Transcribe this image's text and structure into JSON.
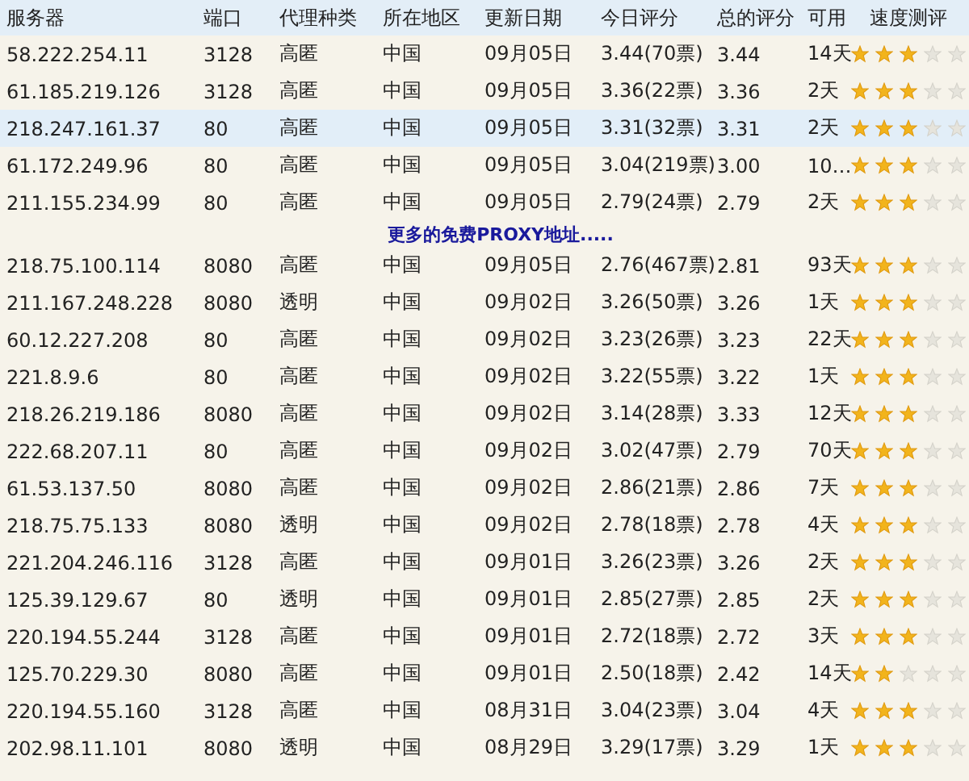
{
  "table": {
    "columns": [
      "服务器",
      "端口",
      "代理种类",
      "所在地区",
      "更新日期",
      "今日评分",
      "总的评分",
      "可用",
      "速度测评"
    ],
    "rows": [
      {
        "cells": [
          "58.222.254.11",
          "3128",
          "高匿",
          "中国",
          "09月05日",
          "3.44(70票)",
          "3.44",
          "14天"
        ],
        "stars": 3,
        "selected": false
      },
      {
        "cells": [
          "61.185.219.126",
          "3128",
          "高匿",
          "中国",
          "09月05日",
          "3.36(22票)",
          "3.36",
          "2天"
        ],
        "stars": 3,
        "selected": false
      },
      {
        "cells": [
          "218.247.161.37",
          "80",
          "高匿",
          "中国",
          "09月05日",
          "3.31(32票)",
          "3.31",
          "2天"
        ],
        "stars": 3,
        "selected": true
      },
      {
        "cells": [
          "61.172.249.96",
          "80",
          "高匿",
          "中国",
          "09月05日",
          "3.04(219票)",
          "3.00",
          "10…"
        ],
        "stars": 3,
        "selected": false
      },
      {
        "cells": [
          "211.155.234.99",
          "80",
          "高匿",
          "中国",
          "09月05日",
          "2.79(24票)",
          "2.79",
          "2天"
        ],
        "stars": 3,
        "selected": false
      }
    ],
    "more_link": "更多的免费PROXY地址.....",
    "rows_2": [
      {
        "cells": [
          "218.75.100.114",
          "8080",
          "高匿",
          "中国",
          "09月05日",
          "2.76(467票)",
          "2.81",
          "93天"
        ],
        "stars": 3,
        "selected": false
      },
      {
        "cells": [
          "211.167.248.228",
          "8080",
          "透明",
          "中国",
          "09月02日",
          "3.26(50票)",
          "3.26",
          "1天"
        ],
        "stars": 3,
        "selected": false
      },
      {
        "cells": [
          "60.12.227.208",
          "80",
          "高匿",
          "中国",
          "09月02日",
          "3.23(26票)",
          "3.23",
          "22天"
        ],
        "stars": 3,
        "selected": false
      },
      {
        "cells": [
          "221.8.9.6",
          "80",
          "高匿",
          "中国",
          "09月02日",
          "3.22(55票)",
          "3.22",
          "1天"
        ],
        "stars": 3,
        "selected": false
      },
      {
        "cells": [
          "218.26.219.186",
          "8080",
          "高匿",
          "中国",
          "09月02日",
          "3.14(28票)",
          "3.33",
          "12天"
        ],
        "stars": 3,
        "selected": false
      },
      {
        "cells": [
          "222.68.207.11",
          "80",
          "高匿",
          "中国",
          "09月02日",
          "3.02(47票)",
          "2.79",
          "70天"
        ],
        "stars": 3,
        "selected": false
      },
      {
        "cells": [
          "61.53.137.50",
          "8080",
          "高匿",
          "中国",
          "09月02日",
          "2.86(21票)",
          "2.86",
          "7天"
        ],
        "stars": 3,
        "selected": false
      },
      {
        "cells": [
          "218.75.75.133",
          "8080",
          "透明",
          "中国",
          "09月02日",
          "2.78(18票)",
          "2.78",
          "4天"
        ],
        "stars": 3,
        "selected": false
      },
      {
        "cells": [
          "221.204.246.116",
          "3128",
          "高匿",
          "中国",
          "09月01日",
          "3.26(23票)",
          "3.26",
          "2天"
        ],
        "stars": 3,
        "selected": false
      },
      {
        "cells": [
          "125.39.129.67",
          "80",
          "透明",
          "中国",
          "09月01日",
          "2.85(27票)",
          "2.85",
          "2天"
        ],
        "stars": 3,
        "selected": false
      },
      {
        "cells": [
          "220.194.55.244",
          "3128",
          "高匿",
          "中国",
          "09月01日",
          "2.72(18票)",
          "2.72",
          "3天"
        ],
        "stars": 3,
        "selected": false
      },
      {
        "cells": [
          "125.70.229.30",
          "8080",
          "高匿",
          "中国",
          "09月01日",
          "2.50(18票)",
          "2.42",
          "14天"
        ],
        "stars": 2,
        "selected": false
      },
      {
        "cells": [
          "220.194.55.160",
          "3128",
          "高匿",
          "中国",
          "08月31日",
          "3.04(23票)",
          "3.04",
          "4天"
        ],
        "stars": 3,
        "selected": false
      },
      {
        "cells": [
          "202.98.11.101",
          "8080",
          "透明",
          "中国",
          "08月29日",
          "3.29(17票)",
          "3.29",
          "1天"
        ],
        "stars": 3,
        "selected": false
      }
    ]
  }
}
